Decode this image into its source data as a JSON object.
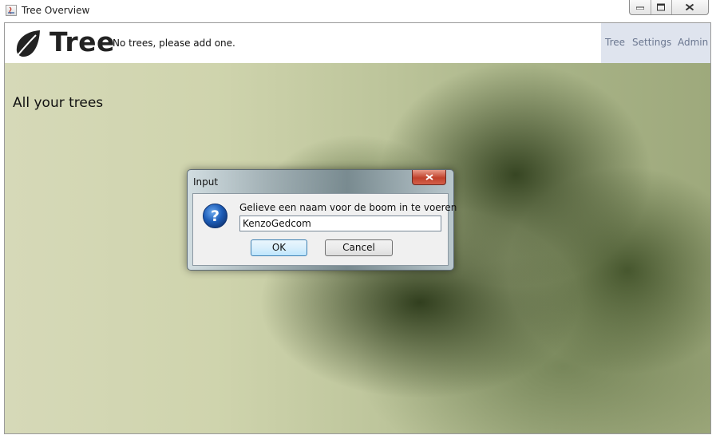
{
  "window": {
    "title": "Tree Overview",
    "controls": {
      "minimize": "minimize-icon",
      "maximize": "maximize-icon",
      "close": "close-icon"
    }
  },
  "header": {
    "logo_text": "Tree",
    "logo_icon": "leaf-icon",
    "notice": "No trees, please add one.",
    "nav": [
      "Tree",
      "Settings",
      "Admin"
    ]
  },
  "main": {
    "heading": "All your trees"
  },
  "dialog": {
    "title": "Input",
    "prompt": "Gelieve een naam voor de boom in te voeren",
    "field_value": "KenzoGedcom",
    "ok_label": "OK",
    "cancel_label": "Cancel",
    "icon": "question-icon"
  },
  "colors": {
    "nav_background": "#dfe4ee",
    "nav_text": "#6b7790",
    "ok_border": "#3c7fb1",
    "dialog_close": "#c0412b"
  }
}
